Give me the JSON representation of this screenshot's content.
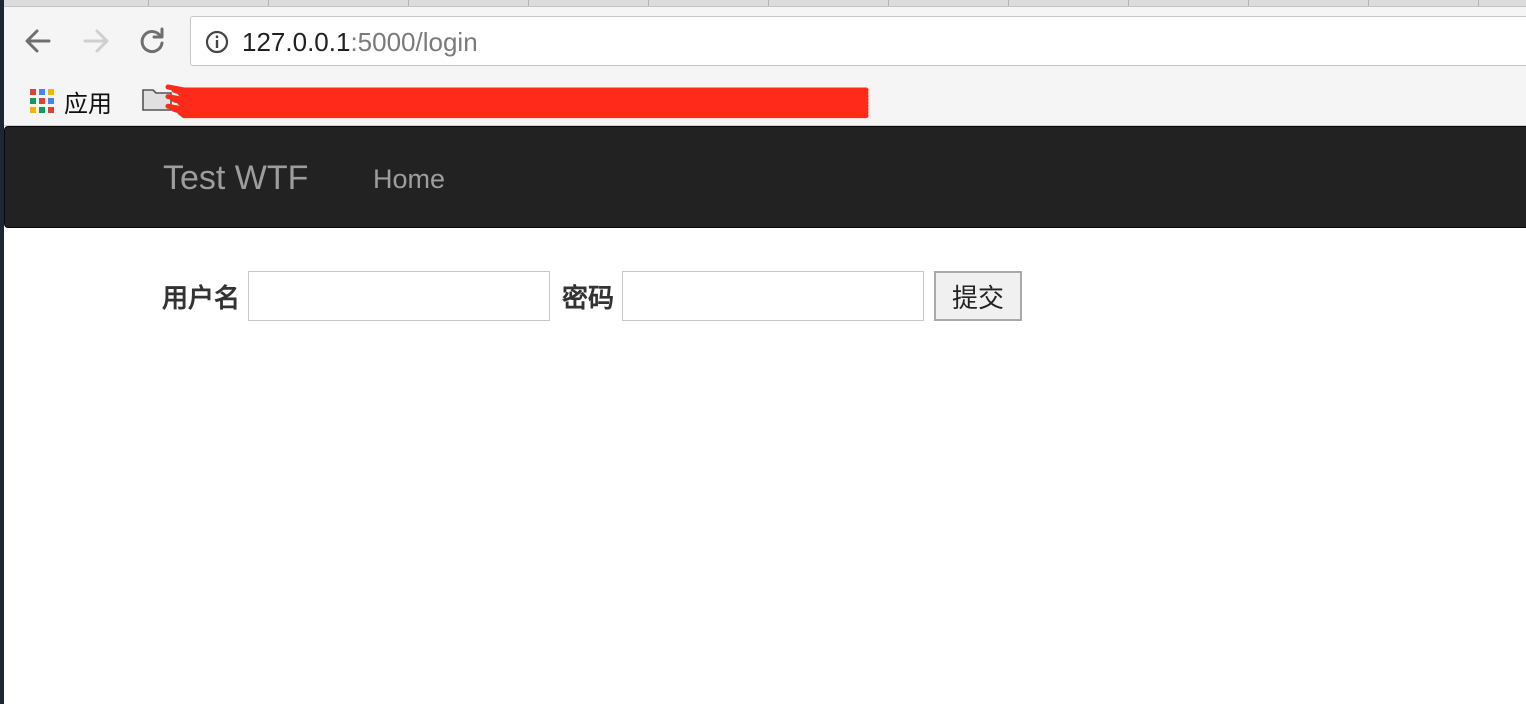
{
  "browser": {
    "url_host": "127.0.0.1",
    "url_rest": ":5000/login",
    "back_icon": "arrow-left-icon",
    "forward_icon": "arrow-right-icon",
    "reload_icon": "reload-icon",
    "info_icon": "info-icon"
  },
  "bookmarks": {
    "apps_label": "应用",
    "apps_icon": "apps-grid-icon",
    "folder_icon": "folder-icon",
    "apps_colors": [
      "#db4437",
      "#4285f4",
      "#f4b400",
      "#0f9d58",
      "#db4437",
      "#4285f4",
      "#f4b400",
      "#0f9d58",
      "#db4437"
    ],
    "redaction_color": "#ff2a1a"
  },
  "navbar": {
    "brand": "Test WTF",
    "home_link": "Home",
    "background": "#222222",
    "text_color": "#9d9d9d"
  },
  "form": {
    "username_label": "用户名",
    "username_value": "",
    "password_label": "密码",
    "password_value": "",
    "submit_label": "提交"
  }
}
